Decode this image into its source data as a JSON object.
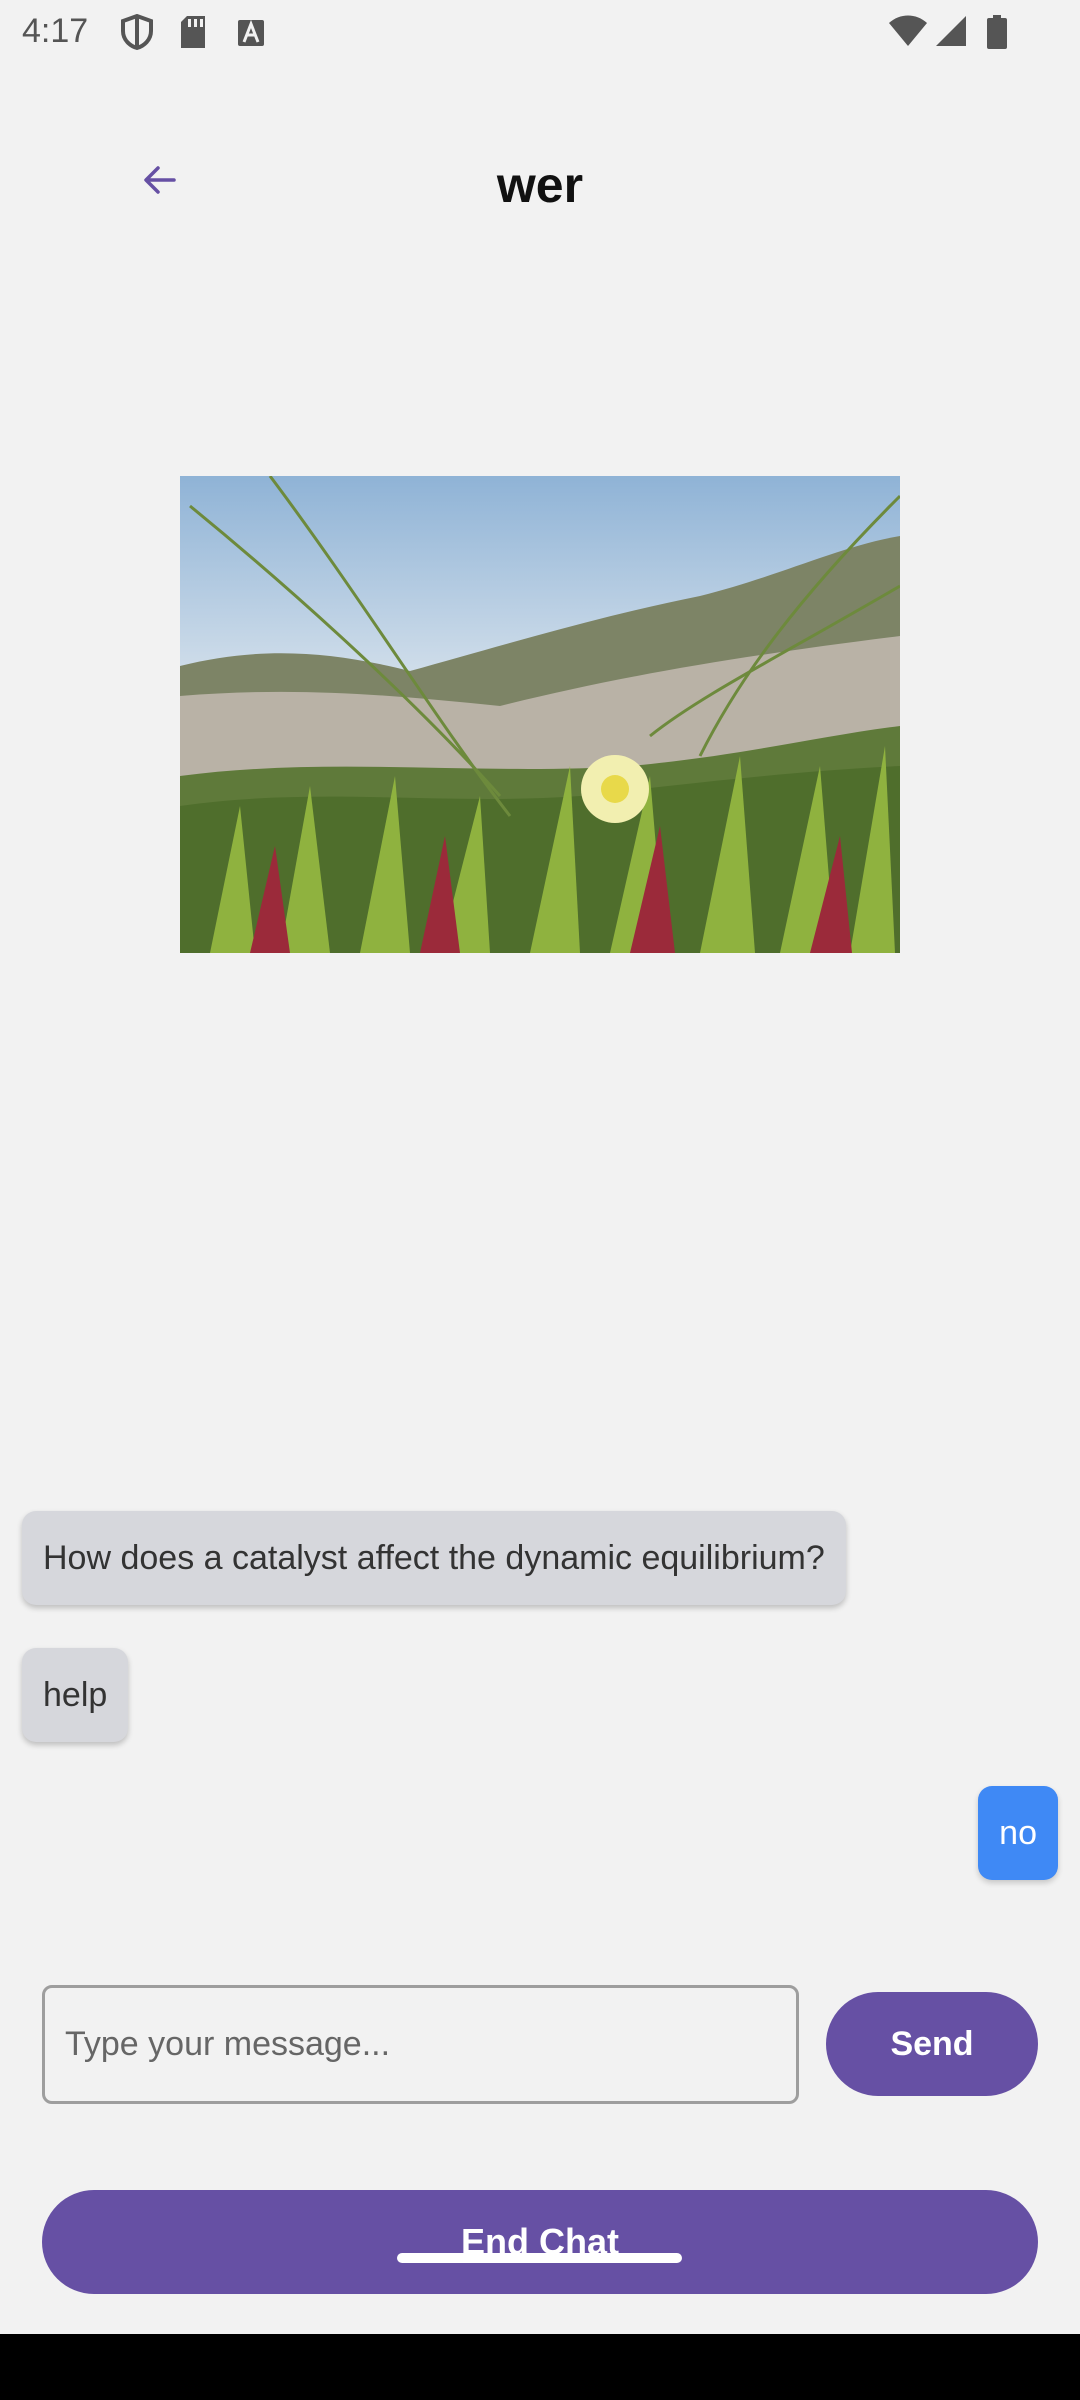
{
  "status_bar": {
    "time": "4:17",
    "icons": [
      "shield-icon",
      "sdcard-icon",
      "a-icon",
      "wifi-icon",
      "signal-icon",
      "battery-icon"
    ]
  },
  "header": {
    "title": "wer",
    "back_icon": "arrow-left-icon",
    "accent_color": "#6650a4"
  },
  "chat": {
    "messages": [
      {
        "text": "How does a catalyst affect the dynamic equilibrium?",
        "sender": "other"
      },
      {
        "text": "help",
        "sender": "other"
      },
      {
        "text": "no",
        "sender": "me"
      }
    ],
    "received_bubble_color": "#d6d7dc",
    "sent_bubble_color": "#3f89f5"
  },
  "composer": {
    "placeholder": "Type your message...",
    "value": "",
    "send_label": "Send"
  },
  "footer": {
    "end_chat_label": "End Chat"
  }
}
